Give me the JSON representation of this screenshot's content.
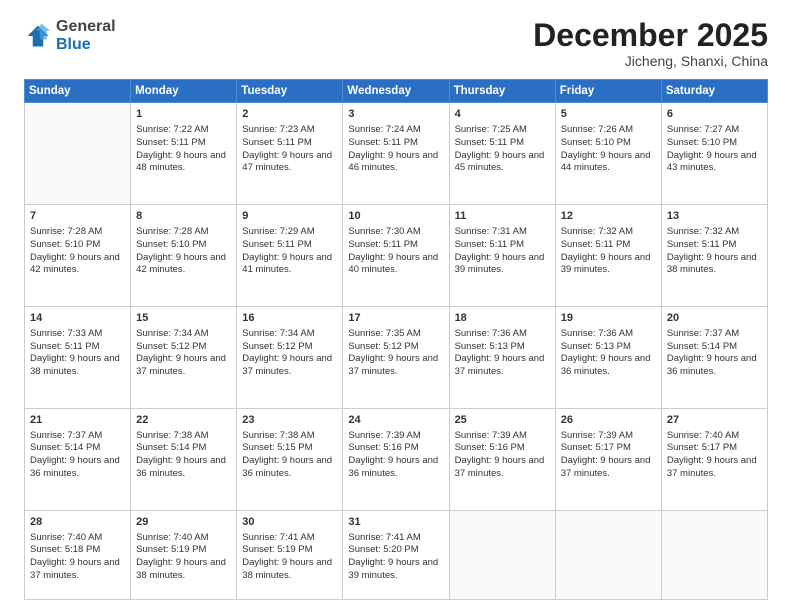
{
  "logo": {
    "general": "General",
    "blue": "Blue"
  },
  "header": {
    "month": "December 2025",
    "location": "Jicheng, Shanxi, China"
  },
  "days": [
    "Sunday",
    "Monday",
    "Tuesday",
    "Wednesday",
    "Thursday",
    "Friday",
    "Saturday"
  ],
  "weeks": [
    [
      {
        "day": "",
        "sunrise": "",
        "sunset": "",
        "daylight": ""
      },
      {
        "day": "1",
        "sunrise": "Sunrise: 7:22 AM",
        "sunset": "Sunset: 5:11 PM",
        "daylight": "Daylight: 9 hours and 48 minutes."
      },
      {
        "day": "2",
        "sunrise": "Sunrise: 7:23 AM",
        "sunset": "Sunset: 5:11 PM",
        "daylight": "Daylight: 9 hours and 47 minutes."
      },
      {
        "day": "3",
        "sunrise": "Sunrise: 7:24 AM",
        "sunset": "Sunset: 5:11 PM",
        "daylight": "Daylight: 9 hours and 46 minutes."
      },
      {
        "day": "4",
        "sunrise": "Sunrise: 7:25 AM",
        "sunset": "Sunset: 5:11 PM",
        "daylight": "Daylight: 9 hours and 45 minutes."
      },
      {
        "day": "5",
        "sunrise": "Sunrise: 7:26 AM",
        "sunset": "Sunset: 5:10 PM",
        "daylight": "Daylight: 9 hours and 44 minutes."
      },
      {
        "day": "6",
        "sunrise": "Sunrise: 7:27 AM",
        "sunset": "Sunset: 5:10 PM",
        "daylight": "Daylight: 9 hours and 43 minutes."
      }
    ],
    [
      {
        "day": "7",
        "sunrise": "Sunrise: 7:28 AM",
        "sunset": "Sunset: 5:10 PM",
        "daylight": "Daylight: 9 hours and 42 minutes."
      },
      {
        "day": "8",
        "sunrise": "Sunrise: 7:28 AM",
        "sunset": "Sunset: 5:10 PM",
        "daylight": "Daylight: 9 hours and 42 minutes."
      },
      {
        "day": "9",
        "sunrise": "Sunrise: 7:29 AM",
        "sunset": "Sunset: 5:11 PM",
        "daylight": "Daylight: 9 hours and 41 minutes."
      },
      {
        "day": "10",
        "sunrise": "Sunrise: 7:30 AM",
        "sunset": "Sunset: 5:11 PM",
        "daylight": "Daylight: 9 hours and 40 minutes."
      },
      {
        "day": "11",
        "sunrise": "Sunrise: 7:31 AM",
        "sunset": "Sunset: 5:11 PM",
        "daylight": "Daylight: 9 hours and 39 minutes."
      },
      {
        "day": "12",
        "sunrise": "Sunrise: 7:32 AM",
        "sunset": "Sunset: 5:11 PM",
        "daylight": "Daylight: 9 hours and 39 minutes."
      },
      {
        "day": "13",
        "sunrise": "Sunrise: 7:32 AM",
        "sunset": "Sunset: 5:11 PM",
        "daylight": "Daylight: 9 hours and 38 minutes."
      }
    ],
    [
      {
        "day": "14",
        "sunrise": "Sunrise: 7:33 AM",
        "sunset": "Sunset: 5:11 PM",
        "daylight": "Daylight: 9 hours and 38 minutes."
      },
      {
        "day": "15",
        "sunrise": "Sunrise: 7:34 AM",
        "sunset": "Sunset: 5:12 PM",
        "daylight": "Daylight: 9 hours and 37 minutes."
      },
      {
        "day": "16",
        "sunrise": "Sunrise: 7:34 AM",
        "sunset": "Sunset: 5:12 PM",
        "daylight": "Daylight: 9 hours and 37 minutes."
      },
      {
        "day": "17",
        "sunrise": "Sunrise: 7:35 AM",
        "sunset": "Sunset: 5:12 PM",
        "daylight": "Daylight: 9 hours and 37 minutes."
      },
      {
        "day": "18",
        "sunrise": "Sunrise: 7:36 AM",
        "sunset": "Sunset: 5:13 PM",
        "daylight": "Daylight: 9 hours and 37 minutes."
      },
      {
        "day": "19",
        "sunrise": "Sunrise: 7:36 AM",
        "sunset": "Sunset: 5:13 PM",
        "daylight": "Daylight: 9 hours and 36 minutes."
      },
      {
        "day": "20",
        "sunrise": "Sunrise: 7:37 AM",
        "sunset": "Sunset: 5:14 PM",
        "daylight": "Daylight: 9 hours and 36 minutes."
      }
    ],
    [
      {
        "day": "21",
        "sunrise": "Sunrise: 7:37 AM",
        "sunset": "Sunset: 5:14 PM",
        "daylight": "Daylight: 9 hours and 36 minutes."
      },
      {
        "day": "22",
        "sunrise": "Sunrise: 7:38 AM",
        "sunset": "Sunset: 5:14 PM",
        "daylight": "Daylight: 9 hours and 36 minutes."
      },
      {
        "day": "23",
        "sunrise": "Sunrise: 7:38 AM",
        "sunset": "Sunset: 5:15 PM",
        "daylight": "Daylight: 9 hours and 36 minutes."
      },
      {
        "day": "24",
        "sunrise": "Sunrise: 7:39 AM",
        "sunset": "Sunset: 5:16 PM",
        "daylight": "Daylight: 9 hours and 36 minutes."
      },
      {
        "day": "25",
        "sunrise": "Sunrise: 7:39 AM",
        "sunset": "Sunset: 5:16 PM",
        "daylight": "Daylight: 9 hours and 37 minutes."
      },
      {
        "day": "26",
        "sunrise": "Sunrise: 7:39 AM",
        "sunset": "Sunset: 5:17 PM",
        "daylight": "Daylight: 9 hours and 37 minutes."
      },
      {
        "day": "27",
        "sunrise": "Sunrise: 7:40 AM",
        "sunset": "Sunset: 5:17 PM",
        "daylight": "Daylight: 9 hours and 37 minutes."
      }
    ],
    [
      {
        "day": "28",
        "sunrise": "Sunrise: 7:40 AM",
        "sunset": "Sunset: 5:18 PM",
        "daylight": "Daylight: 9 hours and 37 minutes."
      },
      {
        "day": "29",
        "sunrise": "Sunrise: 7:40 AM",
        "sunset": "Sunset: 5:19 PM",
        "daylight": "Daylight: 9 hours and 38 minutes."
      },
      {
        "day": "30",
        "sunrise": "Sunrise: 7:41 AM",
        "sunset": "Sunset: 5:19 PM",
        "daylight": "Daylight: 9 hours and 38 minutes."
      },
      {
        "day": "31",
        "sunrise": "Sunrise: 7:41 AM",
        "sunset": "Sunset: 5:20 PM",
        "daylight": "Daylight: 9 hours and 39 minutes."
      },
      {
        "day": "",
        "sunrise": "",
        "sunset": "",
        "daylight": ""
      },
      {
        "day": "",
        "sunrise": "",
        "sunset": "",
        "daylight": ""
      },
      {
        "day": "",
        "sunrise": "",
        "sunset": "",
        "daylight": ""
      }
    ]
  ]
}
